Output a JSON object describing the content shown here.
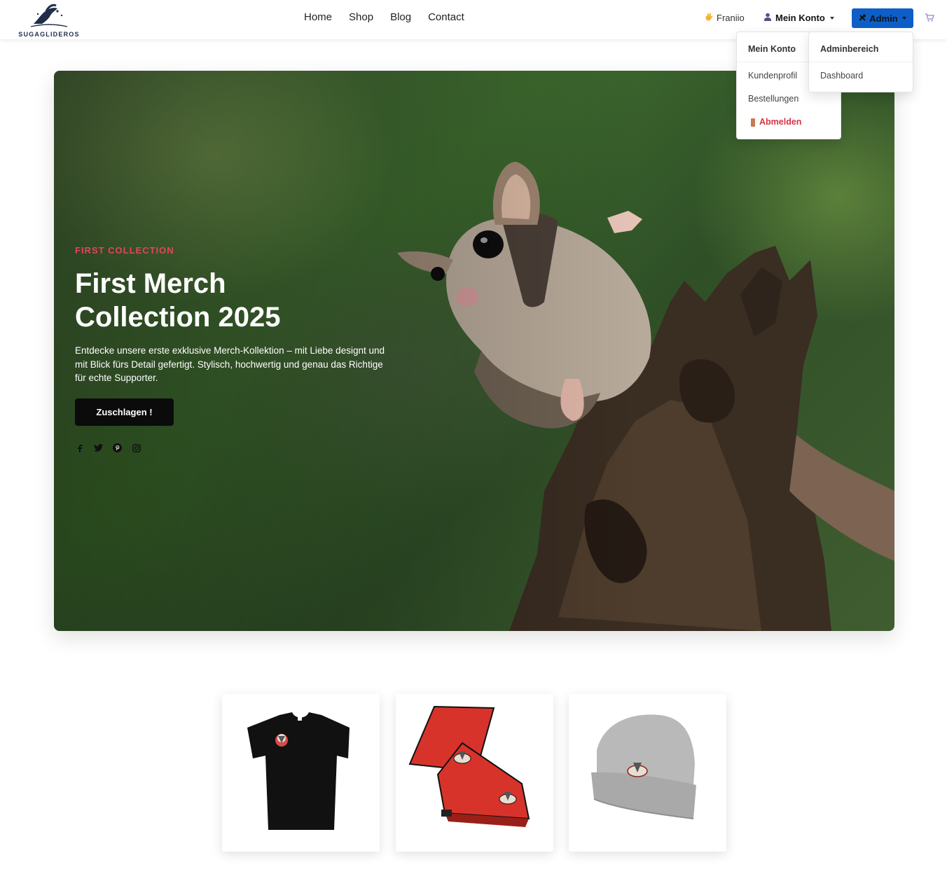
{
  "brand": {
    "name": "SUGAGLIDEROS"
  },
  "nav": {
    "items": [
      "Home",
      "Shop",
      "Blog",
      "Contact"
    ]
  },
  "user": {
    "greeting": "Franiio",
    "account_label": "Mein Konto",
    "admin_label": "Admin"
  },
  "account_menu": {
    "header": "Mein Konto",
    "items": [
      "Kundenprofil",
      "Bestellungen"
    ],
    "logout": "Abmelden"
  },
  "admin_menu": {
    "header": "Adminbereich",
    "items": [
      "Dashboard"
    ]
  },
  "hero": {
    "kicker": "FIRST COLLECTION",
    "title_line1": "First Merch",
    "title_line2": "Collection 2025",
    "description": "Entdecke unsere erste exklusive Merch-Kollektion – mit Liebe designt und mit Blick fürs Detail gefertigt. Stylisch, hochwertig und genau das Richtige für echte Supporter.",
    "cta": "Zuschlagen !",
    "socials": [
      "facebook-icon",
      "twitter-icon",
      "pinterest-icon",
      "instagram-icon"
    ]
  },
  "products": [
    {
      "name": "black-t-shirt",
      "color": "#111111"
    },
    {
      "name": "red-blanket",
      "color": "#d8332b"
    },
    {
      "name": "grey-beanie",
      "color": "#b9b9b9"
    }
  ],
  "colors": {
    "admin_accent": "#0d5fc7",
    "kicker": "#e0475a",
    "logout": "#d63447"
  }
}
